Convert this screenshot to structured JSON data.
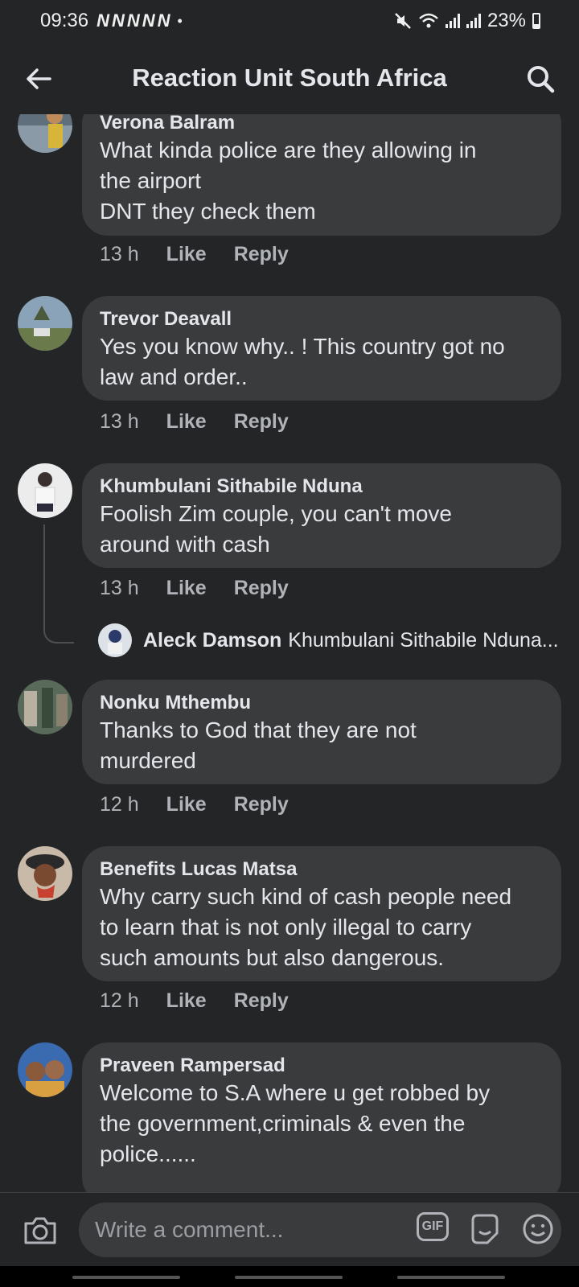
{
  "status_bar": {
    "time": "09:36",
    "notification_icons": [
      "N",
      "N",
      "N",
      "N",
      "N"
    ],
    "dot": "•",
    "battery": "23%"
  },
  "header": {
    "title": "Reaction Unit South Africa",
    "back_icon": "arrow-left-icon",
    "search_icon": "search-icon"
  },
  "comments": [
    {
      "name": "Verona Balram",
      "text": "What kinda police are they allowing in\nthe airport\nDNT they check them",
      "time": "13 h",
      "like": "Like",
      "reply": "Reply",
      "avatar_colors": [
        "#6b7d8a",
        "#c7a03a"
      ]
    },
    {
      "name": "Trevor Deavall",
      "text": "Yes you know why.. ! This country got no\nlaw and order..",
      "time": "13 h",
      "like": "Like",
      "reply": "Reply",
      "avatar_colors": [
        "#8aa3b8",
        "#6a7a4a"
      ]
    },
    {
      "name": "Khumbulani Sithabile Nduna",
      "text": "Foolish Zim couple, you can't move\naround with cash",
      "time": "13 h",
      "like": "Like",
      "reply": "Reply",
      "avatar_colors": [
        "#e8e8e8",
        "#3a3030"
      ]
    },
    {
      "name": "Nonku Mthembu",
      "text": "Thanks to God that they are not\nmurdered",
      "time": "12 h",
      "like": "Like",
      "reply": "Reply",
      "avatar_colors": [
        "#5a6a5a",
        "#b8b0a0"
      ]
    },
    {
      "name": "Benefits Lucas Matsa",
      "text": "Why carry such kind of cash people need\nto learn that is not only illegal to carry\nsuch amounts but also dangerous.",
      "time": "12 h",
      "like": "Like",
      "reply": "Reply",
      "avatar_colors": [
        "#7a4a30",
        "#c84030"
      ]
    },
    {
      "name": "Praveen Rampersad",
      "text": "Welcome to S.A where u get robbed by\nthe government,criminals & even the\npolice......",
      "avatar_colors": [
        "#3a6ab0",
        "#d8a040"
      ]
    }
  ],
  "reply_preview": {
    "name": "Aleck Damson",
    "text": "Khumbulani Sithabile Nduna..."
  },
  "composer": {
    "placeholder": "Write a comment...",
    "gif_label": "GIF",
    "camera_icon": "camera-icon",
    "sticker_icon": "sticker-icon",
    "emoji_icon": "emoji-icon"
  }
}
